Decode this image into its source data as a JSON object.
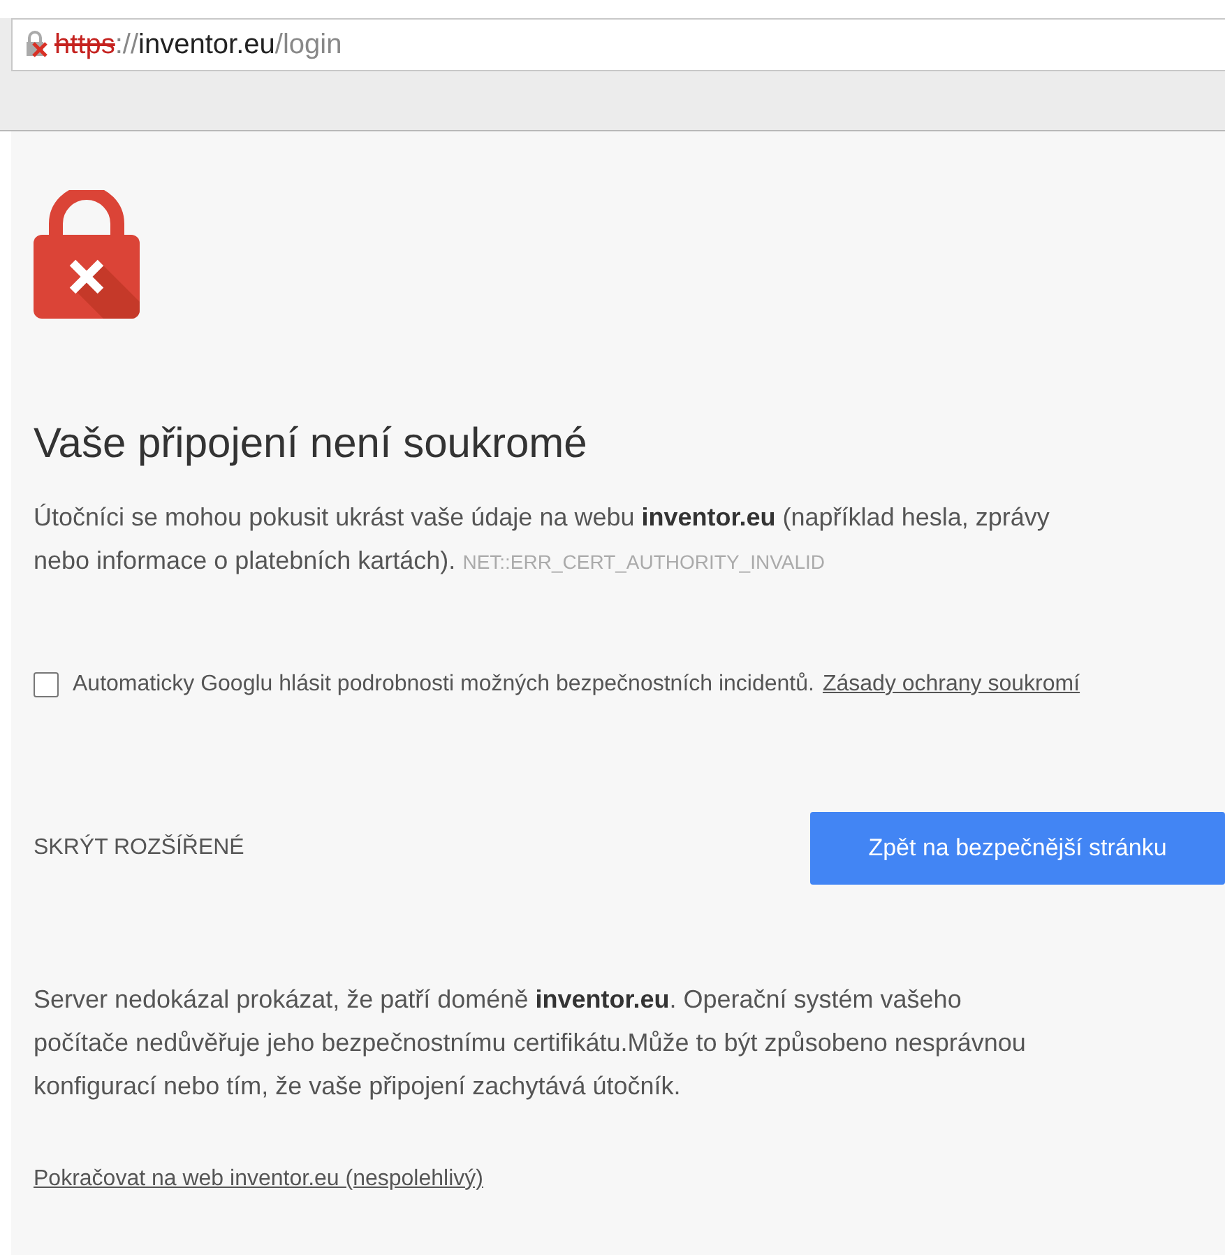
{
  "address_bar": {
    "scheme": "https",
    "separator": "://",
    "host": "inventor.eu",
    "path": "/login",
    "secure": false
  },
  "title": "Vaše připojení není soukromé",
  "intro_lines": [
    "Útočníci se mohou pokusit ukrást vaše údaje na webu **inventor.eu** (například hesla, zprávy",
    "nebo informace o platebních kartách)."
  ],
  "error_code": "NET::ERR_CERT_AUTHORITY_INVALID",
  "report_option": {
    "label": "Automaticky Googlu hlásit podrobnosti možných bezpečnostních incidentů.",
    "link": "Zásady ochrany soukromí",
    "checked": false
  },
  "advanced_toggle": "SKRÝT ROZŠÍŘENÉ",
  "back_button": "Zpět na bezpečnější stránku",
  "details_lines": [
    "Server nedokázal prokázat, že patří doméně **inventor.eu**. Operační systém vašeho",
    "počítače nedůvěřuje jeho bezpečnostnímu certifikátu.Může to být způsobeno nesprávnou",
    "konfigurací nebo tím, že vaše připojení zachytává útočník."
  ],
  "proceed_link": "Pokračovat na web inventor.eu (nespolehlivý)"
}
